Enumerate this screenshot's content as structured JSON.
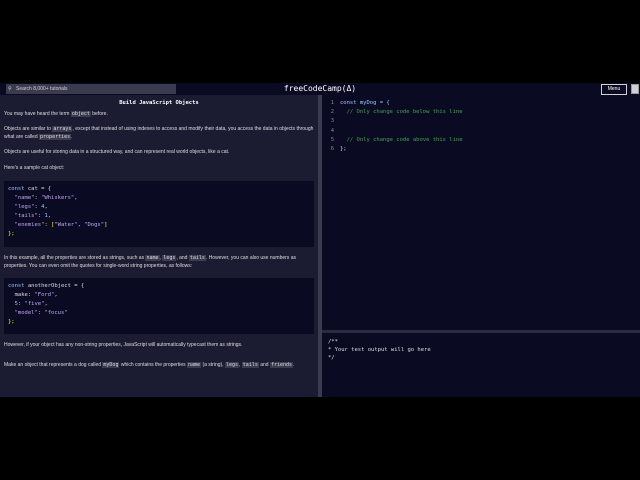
{
  "nav": {
    "search_placeholder": "Search 8,000+ tutorials",
    "logo": "freeCodeCamp(Δ)",
    "menu_label": "Menu"
  },
  "lesson": {
    "title": "Build JavaScript Objects",
    "p1": [
      "You may have heard the term ",
      "object",
      " before."
    ],
    "p2": [
      "Objects are similar to ",
      "arrays",
      ", except that instead of using indexes to access and modify their data, you access the data in objects through what are called ",
      "properties",
      "."
    ],
    "p3": "Objects are useful for storing data in a structured way, and can represent real world objects, like a cat.",
    "p4": "Here's a sample cat object:",
    "cat_code": {
      "l1": [
        "const",
        " cat = {"
      ],
      "l2": [
        "  \"name\"",
        ": ",
        "\"Whiskers\"",
        ","
      ],
      "l3": [
        "  \"legs\"",
        ": ",
        "4",
        ","
      ],
      "l4": [
        "  \"tails\"",
        ": ",
        "1",
        ","
      ],
      "l5": [
        "  \"enemies\"",
        ": [",
        "\"Water\"",
        ", ",
        "\"Dogs\"",
        "]"
      ],
      "l6": "};"
    },
    "p5": [
      "In this example, all the properties are stored as strings, such as ",
      "name",
      ", ",
      "legs",
      ", and ",
      "tails",
      ". However, you can also use numbers as properties. You can even omit the quotes for single-word string properties, as follows:"
    ],
    "obj_code": {
      "l1": [
        "const",
        " anotherObject = {"
      ],
      "l2": [
        "  make",
        ": ",
        "\"Ford\"",
        ","
      ],
      "l3": [
        "  5",
        ": ",
        "\"five\"",
        ","
      ],
      "l4": [
        "  \"model\"",
        ": ",
        "\"focus\""
      ],
      "l5": "};"
    },
    "p6": "However, if your object has any non-string properties, JavaScript will automatically typecast them as strings.",
    "p7": [
      "Make an object that represents a dog called ",
      "myDog",
      " which contains the properties ",
      "name",
      " (a string), ",
      "legs",
      ", ",
      "tails",
      " and ",
      "friends",
      "."
    ]
  },
  "editor": {
    "lines": [
      {
        "n": "1",
        "code": "const myDog = {"
      },
      {
        "n": "2",
        "code": "  // Only change code below this line"
      },
      {
        "n": "3",
        "code": ""
      },
      {
        "n": "4",
        "code": ""
      },
      {
        "n": "5",
        "code": "  // Only change code above this line"
      },
      {
        "n": "6",
        "code": "};"
      }
    ]
  },
  "console": {
    "l1": "/**",
    "l2": "* Your test output will go here",
    "l3": "*/"
  }
}
